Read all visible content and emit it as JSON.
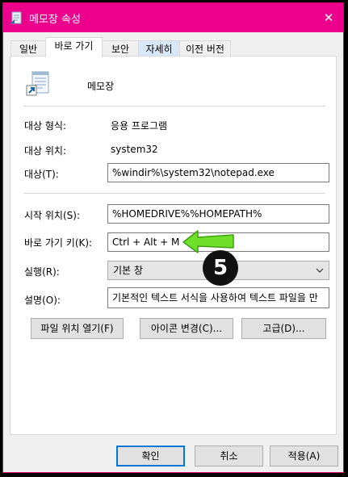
{
  "window": {
    "title": "메모장 속성",
    "close_symbol": "✕"
  },
  "tabs": [
    {
      "label": "일반"
    },
    {
      "label": "바로 가기"
    },
    {
      "label": "보안"
    },
    {
      "label": "자세히"
    },
    {
      "label": "이전 버전"
    }
  ],
  "general": {
    "app_name": "메모장",
    "icon": "notepad-shortcut-icon",
    "target_type_label": "대상 형식:",
    "target_type_value": "응용 프로그램",
    "target_location_label": "대상 위치:",
    "target_location_value": "system32",
    "target_label": "대상(T):",
    "target_value": "%windir%\\system32\\notepad.exe",
    "start_in_label": "시작 위치(S):",
    "start_in_value": "%HOMEDRIVE%%HOMEPATH%",
    "shortcut_key_label": "바로 가기 키(K):",
    "shortcut_key_value": "Ctrl + Alt + M",
    "run_label": "실행(R):",
    "run_value": "기본 창",
    "comment_label": "설명(O):",
    "comment_value": "기본적인 텍스트 서식을 사용하여 텍스트 파일을 만"
  },
  "action_buttons": {
    "open_location": "파일 위치 열기(F)",
    "change_icon": "아이콘 변경(C)...",
    "advanced": "고급(D)..."
  },
  "footer": {
    "ok": "확인",
    "cancel": "취소",
    "apply": "적용(A)"
  },
  "annotation": {
    "step_number": "5",
    "arrow_color": "#5bd41a"
  }
}
